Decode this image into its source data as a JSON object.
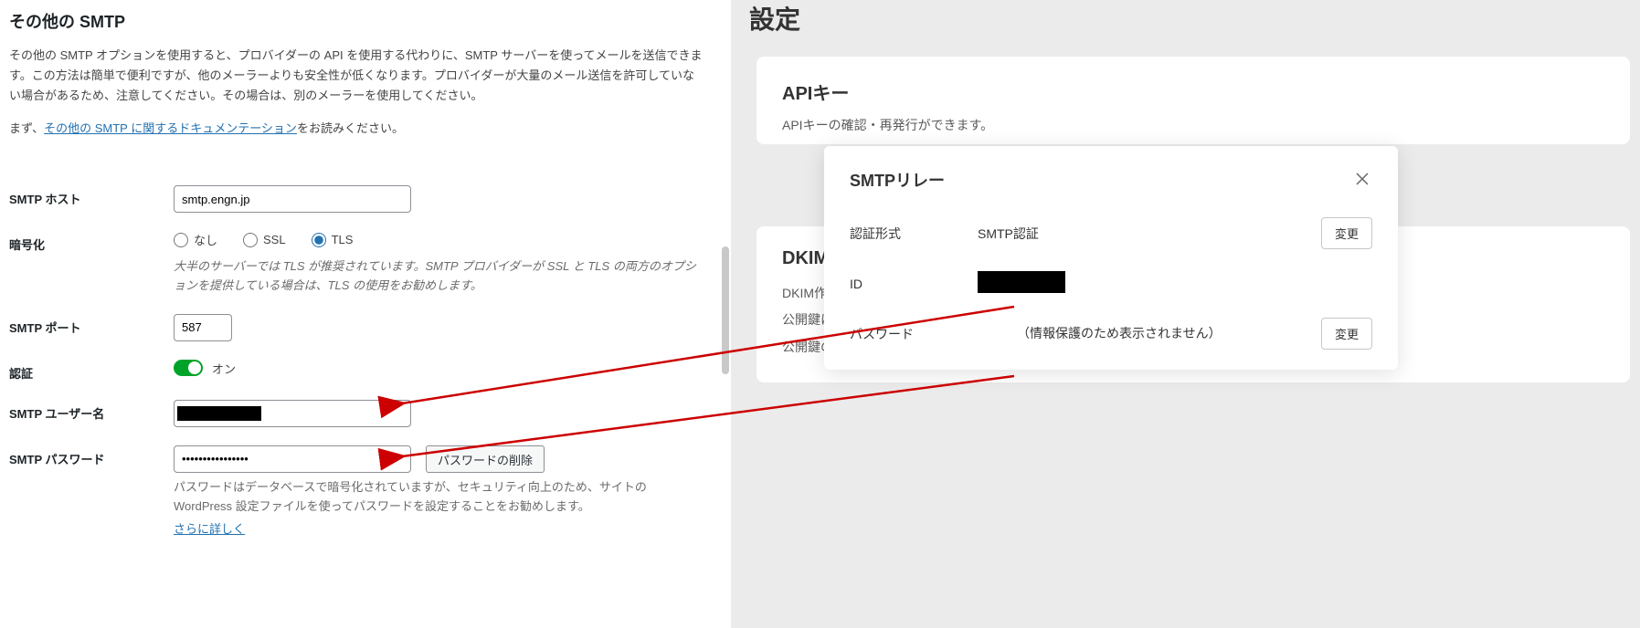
{
  "left": {
    "heading": "その他の SMTP",
    "description": "その他の SMTP オプションを使用すると、プロバイダーの API を使用する代わりに、SMTP サーバーを使ってメールを送信できます。この方法は簡単で便利ですが、他のメーラーよりも安全性が低くなります。プロバイダーが大量のメール送信を許可していない場合があるため、注意してください。その場合は、別のメーラーを使用してください。",
    "doc_prefix": "まず、",
    "doc_link": "その他の SMTP に関するドキュメンテーション",
    "doc_suffix": "をお読みください。",
    "host_label": "SMTP ホスト",
    "host_value": "smtp.engn.jp",
    "enc_label": "暗号化",
    "enc_none": "なし",
    "enc_ssl": "SSL",
    "enc_tls": "TLS",
    "enc_help": "大半のサーバーでは TLS が推奨されています。SMTP プロバイダーが SSL と TLS の両方のオプションを提供している場合は、TLS の使用をお勧めします。",
    "port_label": "SMTP ポート",
    "port_value": "587",
    "auth_label": "認証",
    "auth_on": "オン",
    "user_label": "SMTP ユーザー名",
    "pass_label": "SMTP パスワード",
    "pass_value": "••••••••••••••••",
    "pass_remove": "パスワードの削除",
    "pass_help": "パスワードはデータベースで暗号化されていますが、セキュリティ向上のため、サイトの WordPress 設定ファイルを使ってパスワードを設定することをお勧めします。",
    "more_link": "さらに詳しく"
  },
  "right": {
    "page_title": "設定",
    "api": {
      "title": "APIキー",
      "desc": "APIキーの確認・再発行ができます。"
    },
    "dkim": {
      "title": "DKIM",
      "row1": "DKIM作",
      "row2": "公開鍵に",
      "row3": "公開鍵の"
    }
  },
  "modal": {
    "title": "SMTPリレー",
    "auth_type_label": "認証形式",
    "auth_type_value": "SMTP認証",
    "id_label": "ID",
    "pass_label": "パスワード",
    "pass_value": "（情報保護のため表示されません）",
    "change_btn": "変更"
  }
}
